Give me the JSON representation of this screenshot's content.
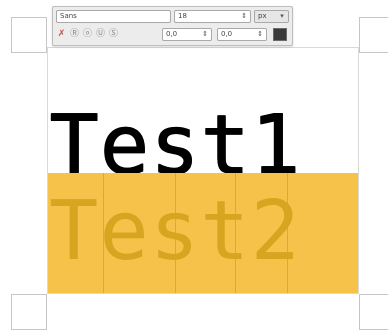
{
  "toolbar": {
    "font_name": "Sans",
    "font_size": "18",
    "unit": "px",
    "offset_x": "0,0",
    "offset_y": "0,0",
    "text_color": "#3a3a3a",
    "icons": [
      "clear-style-icon",
      "bold-icon",
      "italic-icon",
      "underline-icon",
      "strikethrough-icon"
    ]
  },
  "canvas": {
    "text1": "Test1",
    "text2": "Test2",
    "text2_background": "#f6c24a"
  }
}
